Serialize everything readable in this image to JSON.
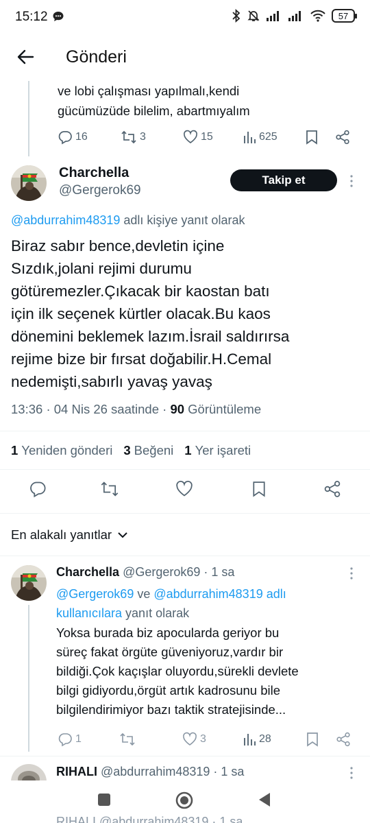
{
  "status_bar": {
    "time": "15:12",
    "battery": "57"
  },
  "header": {
    "title": "Gönderi"
  },
  "parent_tweet": {
    "text_line1": "ve lobi çalışması yapılmalı,kendi",
    "text_line2": "gücümüzüde bilelim, abartmıyalım",
    "replies": "16",
    "retweets": "3",
    "likes": "15",
    "views": "625"
  },
  "main_tweet": {
    "name": "Charchella",
    "handle": "@Gergerok69",
    "follow_label": "Takip et",
    "replying_mention": "@abdurrahim48319",
    "replying_suffix": " adlı kişiye yanıt olarak",
    "body_lines": [
      "Biraz sabır bence,devletin içine",
      "Sızdık,jolani rejimi durumu",
      "götüremezler.Çıkacak bir kaostan batı",
      "için ilk seçenek kürtler olacak.Bu kaos",
      "dönemini beklemek lazım.İsrail saldırırsa",
      "rejime bize bir fırsat doğabilir.H.Cemal",
      "nedemişti,sabırlı yavaş yavaş"
    ],
    "time": "13:36",
    "date": "04 Nis 26 saatinde",
    "views_count": "90",
    "views_label": "Görüntüleme",
    "retweet_count": "1",
    "retweet_label": "Yeniden gönderi",
    "like_count": "3",
    "like_label": "Beğeni",
    "bookmark_count": "1",
    "bookmark_label": "Yer işareti"
  },
  "replies_sort": {
    "label": "En alakalı yanıtlar"
  },
  "reply1": {
    "name": "Charchella",
    "handle": "@Gergerok69",
    "age": "1 sa",
    "mention1": "@Gergerok69",
    "connector": " ve ",
    "mention2": "@abdurrahim48319",
    "mention_suffix": " adlı",
    "line2_link": "kullanıcılara",
    "line2_suffix": " yanıt olarak",
    "body_lines": [
      "Yoksa burada biz apoculardа geriyor bu",
      "süreç fakat örgüte güveniyoruz,vardır bir",
      "bildiği.Çok kaçışlar oluyordu,sürekli devlete",
      "bilgi gidiyordu,örgüt artık kadrosunu bile",
      "bilgilendirimiyor bazı taktik stratejisinde..."
    ],
    "replies": "1",
    "likes": "3",
    "views": "28"
  },
  "reply2": {
    "name": "RIHALI",
    "handle": "@abdurrahim48319",
    "age": "1 sa"
  },
  "peek_text": "RIHALI @abdurrahim48319 · 1 sa",
  "colors": {
    "link": "#1d9bf0",
    "muted": "#536471",
    "text": "#0f1419",
    "button": "#0f1419"
  }
}
